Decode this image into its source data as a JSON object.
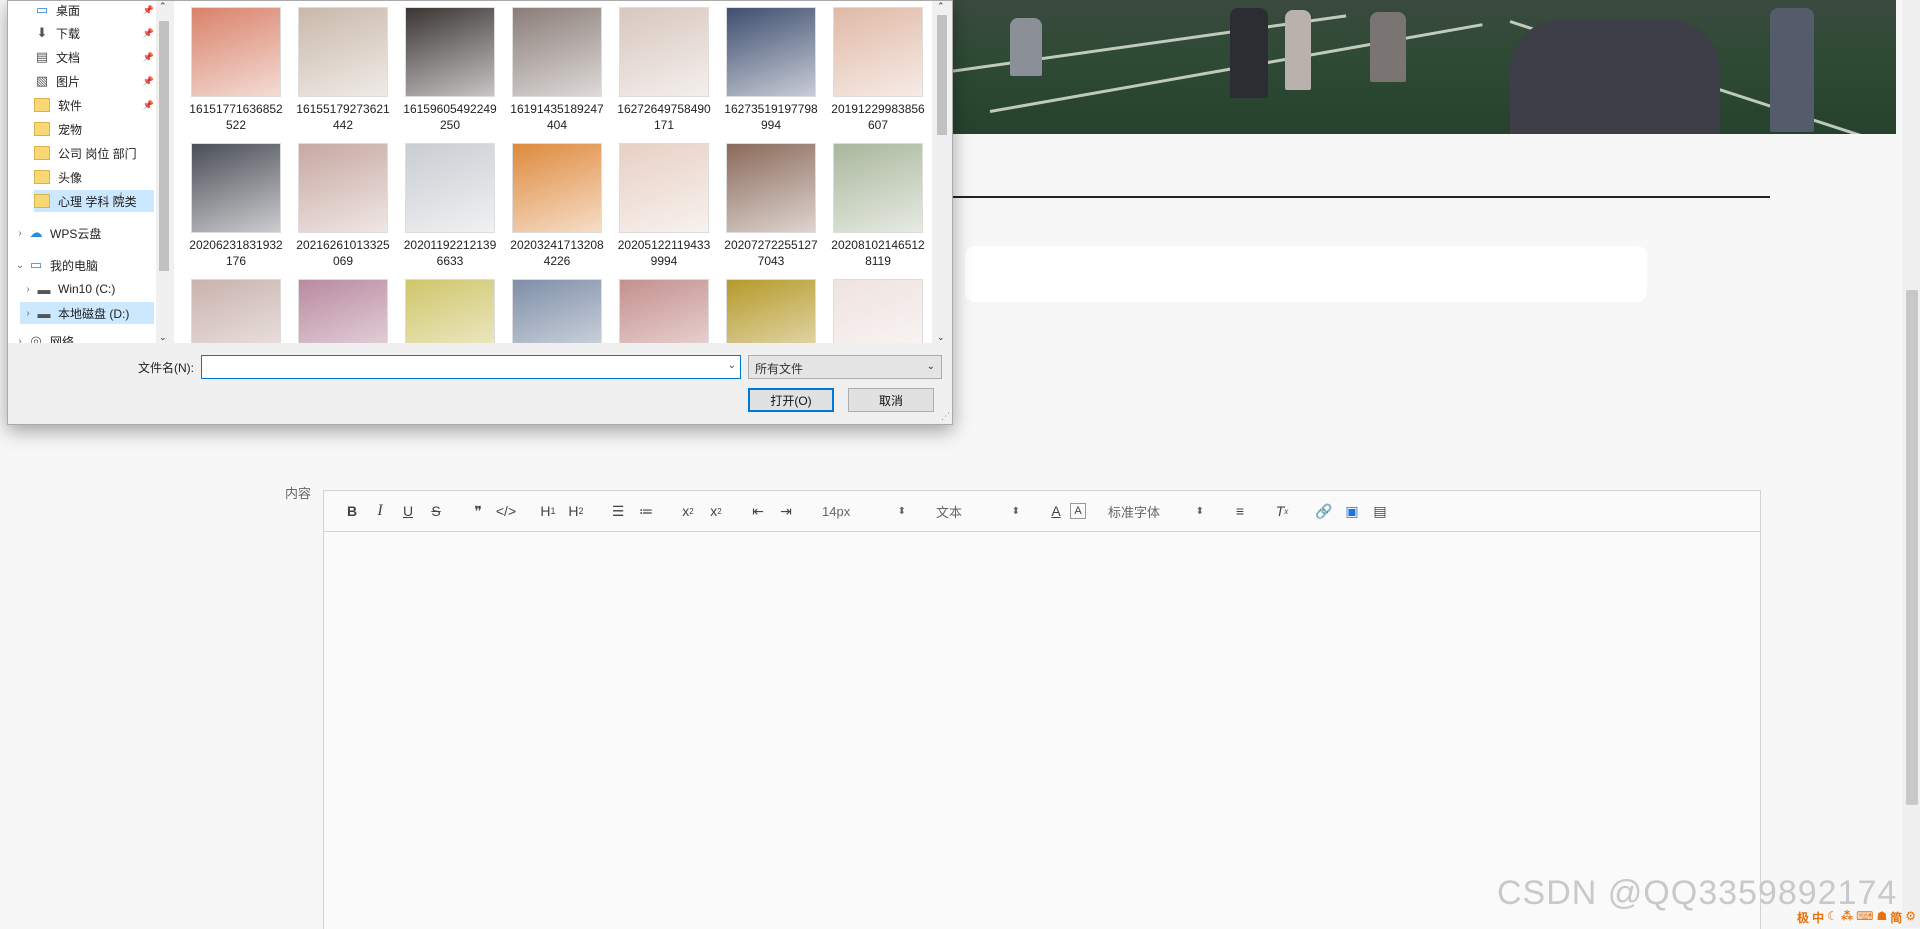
{
  "nav": {
    "items": [
      {
        "label": "桌面",
        "icon": "desktop-icon",
        "pinned": true
      },
      {
        "label": "下载",
        "icon": "download-icon",
        "pinned": true
      },
      {
        "label": "文档",
        "icon": "document-icon",
        "pinned": true
      },
      {
        "label": "图片",
        "icon": "picture-icon",
        "pinned": true
      },
      {
        "label": "软件",
        "icon": "folder-icon",
        "pinned": true
      },
      {
        "label": "宠物",
        "icon": "folder-icon"
      },
      {
        "label": "公司 岗位 部门",
        "icon": "folder-icon"
      },
      {
        "label": "头像",
        "icon": "folder-icon"
      },
      {
        "label": "心理 学科 院类",
        "icon": "folder-icon",
        "selected": true
      },
      {
        "label": "WPS云盘",
        "icon": "cloud-icon"
      },
      {
        "label": "我的电脑",
        "icon": "computer-icon"
      },
      {
        "label": "Win10 (C:)",
        "icon": "drive-icon"
      },
      {
        "label": "本地磁盘 (D:)",
        "icon": "drive-icon",
        "selected": true
      },
      {
        "label": "网络",
        "icon": "network-icon"
      }
    ]
  },
  "files": [
    {
      "name": "16151771636852522",
      "color": "#d9826a"
    },
    {
      "name": "16155179273621442",
      "color": "#c9b8aa"
    },
    {
      "name": "16159605492249250",
      "color": "#3a3533"
    },
    {
      "name": "16191435189247404",
      "color": "#8a7d78"
    },
    {
      "name": "16272649758490171",
      "color": "#d8c7be"
    },
    {
      "name": "16273519197798994",
      "color": "#3e4e6f"
    },
    {
      "name": "20191229983856607",
      "color": "#e0b9a6"
    },
    {
      "name": "20206231831932176",
      "color": "#4a4e56"
    },
    {
      "name": "20216261013325069",
      "color": "#c7a8a1"
    },
    {
      "name": "202011922121396633",
      "color": "#c9cdd2"
    },
    {
      "name": "202032417132084226",
      "color": "#de8a3d"
    },
    {
      "name": "202051221194339994",
      "color": "#e7d0c4"
    },
    {
      "name": "202072722551277043",
      "color": "#8a6a5a"
    },
    {
      "name": "202081021465128119",
      "color": "#a9b79c"
    },
    {
      "name": "",
      "color": "#c9b2ad"
    },
    {
      "name": "",
      "color": "#b98aa0"
    },
    {
      "name": "",
      "color": "#cfc66a"
    },
    {
      "name": "",
      "color": "#7f8fa8"
    },
    {
      "name": "",
      "color": "#c4908e"
    },
    {
      "name": "",
      "color": "#b59a2a"
    },
    {
      "name": "",
      "color": "#efe3e0"
    }
  ],
  "dialog": {
    "filename_label": "文件名(N):",
    "filename_value": "",
    "filetype_value": "所有文件",
    "open_button": "打开(O)",
    "cancel_button": "取消"
  },
  "page": {
    "content_label": "内容",
    "watermark": "CSDN @QQ3359892174"
  },
  "editor": {
    "font_size": "14px",
    "paragraph": "文本",
    "font_family": "标准字体"
  },
  "tray": {
    "items": [
      "极",
      "中",
      "☾",
      "⁂",
      "⌨",
      "☗",
      "简",
      "⚙"
    ]
  }
}
